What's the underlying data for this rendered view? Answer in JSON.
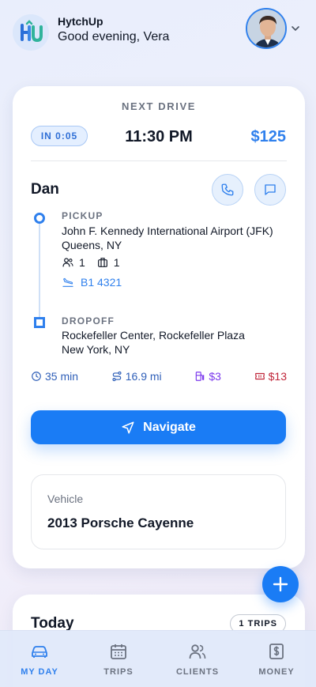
{
  "header": {
    "brand": "HytchUp",
    "greeting": "Good evening, Vera",
    "logo_text": "HU"
  },
  "next_drive": {
    "heading": "NEXT DRIVE",
    "eta_badge": "IN 0:05",
    "time": "11:30 PM",
    "price": "$125",
    "client_name": "Dan",
    "pickup": {
      "label": "PICKUP",
      "address_line1": "John F. Kennedy International Airport (JFK)",
      "address_line2": "Queens, NY",
      "passengers": "1",
      "bags": "1",
      "flight": "B1 4321"
    },
    "dropoff": {
      "label": "DROPOFF",
      "address_line1": "Rockefeller Center, Rockefeller Plaza",
      "address_line2": "New York, NY"
    },
    "stats": {
      "duration": "35 min",
      "distance": "16.9 mi",
      "fuel": "$3",
      "tolls": "$13"
    },
    "navigate_label": "Navigate",
    "vehicle_label": "Vehicle",
    "vehicle_name": "2013 Porsche Cayenne"
  },
  "today": {
    "title": "Today",
    "trips_badge": "1 TRIPS"
  },
  "tabs": [
    {
      "label": "MY DAY",
      "icon": "car-icon",
      "active": true
    },
    {
      "label": "TRIPS",
      "icon": "calendar-icon",
      "active": false
    },
    {
      "label": "CLIENTS",
      "icon": "users-icon",
      "active": false
    },
    {
      "label": "MONEY",
      "icon": "dollar-doc-icon",
      "active": false
    }
  ],
  "colors": {
    "accent": "#1a7cf5",
    "price": "#2f80ed",
    "duration": "#2f5fb8",
    "distance": "#2f5fb8",
    "fuel": "#7c3aed",
    "tolls": "#c0263a"
  }
}
